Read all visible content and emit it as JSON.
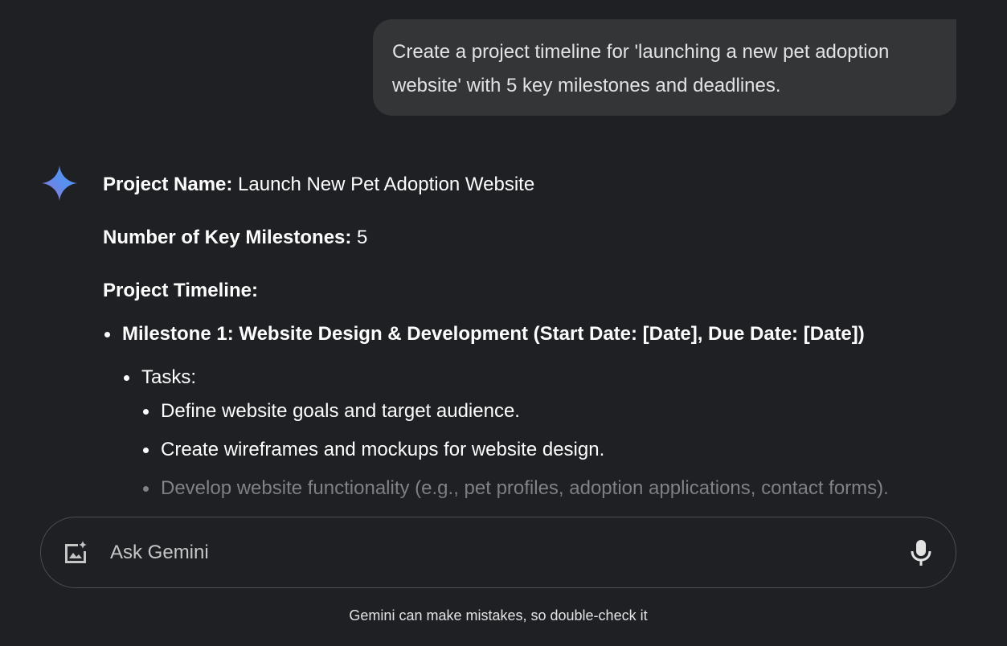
{
  "user_message": "Create a project timeline for 'launching a new pet adoption website' with 5 key milestones and deadlines.",
  "response": {
    "project_name_label": "Project Name:",
    "project_name_value": " Launch New Pet Adoption Website",
    "milestones_count_label": "Number of Key Milestones:",
    "milestones_count_value": " 5",
    "timeline_heading": "Project Timeline:",
    "milestone_1": "Milestone 1: Website Design & Development (Start Date: [Date], Due Date: [Date])",
    "tasks_label": "Tasks:",
    "tasks": [
      "Define website goals and target audience.",
      "Create wireframes and mockups for website design.",
      "Develop website functionality (e.g., pet profiles, adoption applications, contact forms)."
    ]
  },
  "input": {
    "placeholder": "Ask Gemini",
    "value": ""
  },
  "disclaimer": "Gemini can make mistakes, so double-check it",
  "icons": {
    "assistant": "gemini-sparkle-icon",
    "image_upload": "add-image-icon",
    "mic": "microphone-icon"
  },
  "colors": {
    "background": "#1f2023",
    "user_bubble": "#333537",
    "text": "#e3e3e3",
    "sparkle_blue": "#4b8cf5",
    "sparkle_purple": "#9b72cb"
  }
}
